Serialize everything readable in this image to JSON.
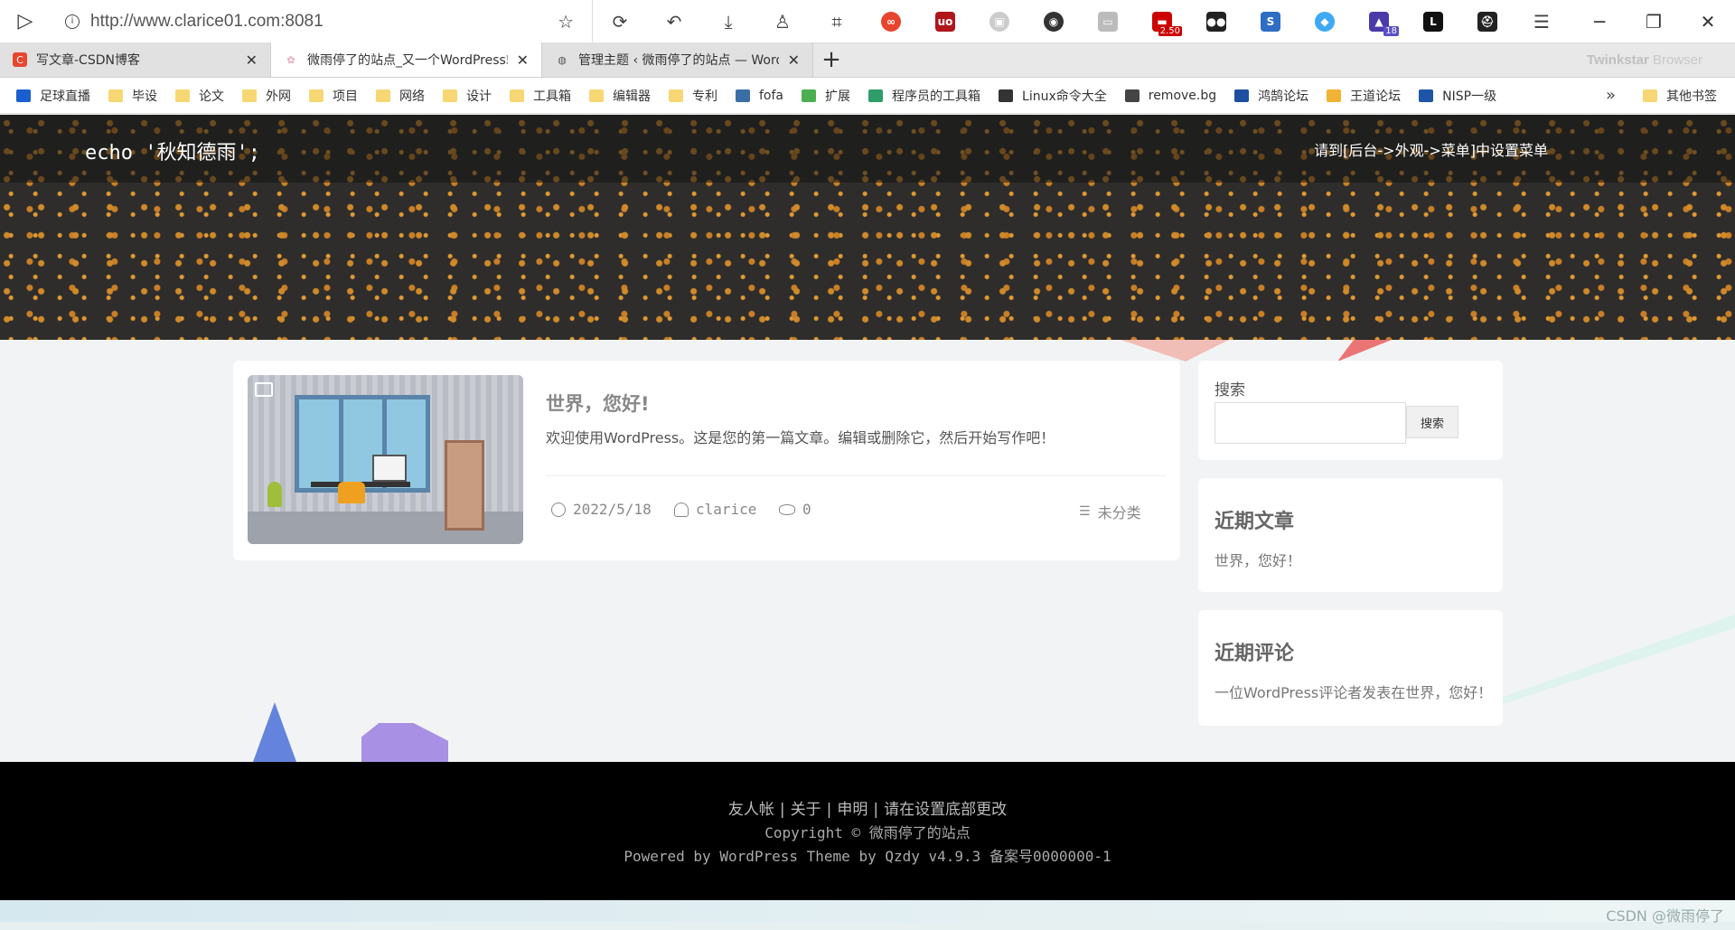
{
  "browser": {
    "url": "http://www.clarice01.com:8081",
    "brand_strong": "Twinkstar",
    "brand_light": "Browser",
    "badges": {
      "abp": "2.50",
      "ext": "18"
    },
    "tabs": [
      {
        "title": "写文章-CSDN博客",
        "favicon_color": "#e8462f",
        "favicon_glyph": "C",
        "active": false
      },
      {
        "title": "微雨停了的站点_又一个WordPress站点",
        "favicon_color": "#f2a6b8",
        "favicon_glyph": "✿",
        "active": true
      },
      {
        "title": "管理主题 ‹ 微雨停了的站点 — WordPress",
        "favicon_color": "#555555",
        "favicon_glyph": "◍",
        "active": false
      }
    ],
    "bookmarks": [
      {
        "label": "足球直播",
        "kind": "site",
        "color": "#1a5fd0"
      },
      {
        "label": "毕设",
        "kind": "folder"
      },
      {
        "label": "论文",
        "kind": "folder"
      },
      {
        "label": "外网",
        "kind": "folder"
      },
      {
        "label": "项目",
        "kind": "folder"
      },
      {
        "label": "网络",
        "kind": "folder"
      },
      {
        "label": "设计",
        "kind": "folder"
      },
      {
        "label": "工具箱",
        "kind": "folder"
      },
      {
        "label": "编辑器",
        "kind": "folder"
      },
      {
        "label": "专利",
        "kind": "folder"
      },
      {
        "label": "fofa",
        "kind": "site",
        "color": "#3a6ea5"
      },
      {
        "label": "扩展",
        "kind": "site",
        "color": "#4caf50"
      },
      {
        "label": "程序员的工具箱",
        "kind": "site",
        "color": "#2e9d6a"
      },
      {
        "label": "Linux命令大全",
        "kind": "site",
        "color": "#333333"
      },
      {
        "label": "remove.bg",
        "kind": "site",
        "color": "#444444"
      },
      {
        "label": "鸿鹄论坛",
        "kind": "site",
        "color": "#1d4fa0"
      },
      {
        "label": "王道论坛",
        "kind": "site",
        "color": "#f2b233"
      },
      {
        "label": "NISP一级",
        "kind": "site",
        "color": "#1d56a8"
      }
    ],
    "other_bookmarks": "其他书签"
  },
  "site": {
    "title": "echo '秋知德雨';",
    "menu_hint": "请到[后台->外观->菜单]中设置菜单"
  },
  "post": {
    "title": "世界，您好!",
    "excerpt": "欢迎使用WordPress。这是您的第一篇文章。编辑或删除它，然后开始写作吧！",
    "date": "2022/5/18",
    "author": "clarice",
    "views": "0",
    "category": "未分类"
  },
  "sidebar": {
    "search_label": "搜索",
    "search_button": "搜索",
    "search_value": "",
    "recent_title": "近期文章",
    "recent_item": "世界，您好！",
    "comments_title": "近期评论",
    "comments_item": "一位WordPress评论者发表在世界，您好！"
  },
  "footer": {
    "links": [
      "友人帐",
      "关于",
      "申明",
      "请在设置底部更改"
    ],
    "copyright": "Copyright © 微雨停了的站点",
    "powered": "Powered by WordPress Theme by Qzdy v4.9.3 备案号0000000-1"
  },
  "watermark": "CSDN @微雨停了"
}
